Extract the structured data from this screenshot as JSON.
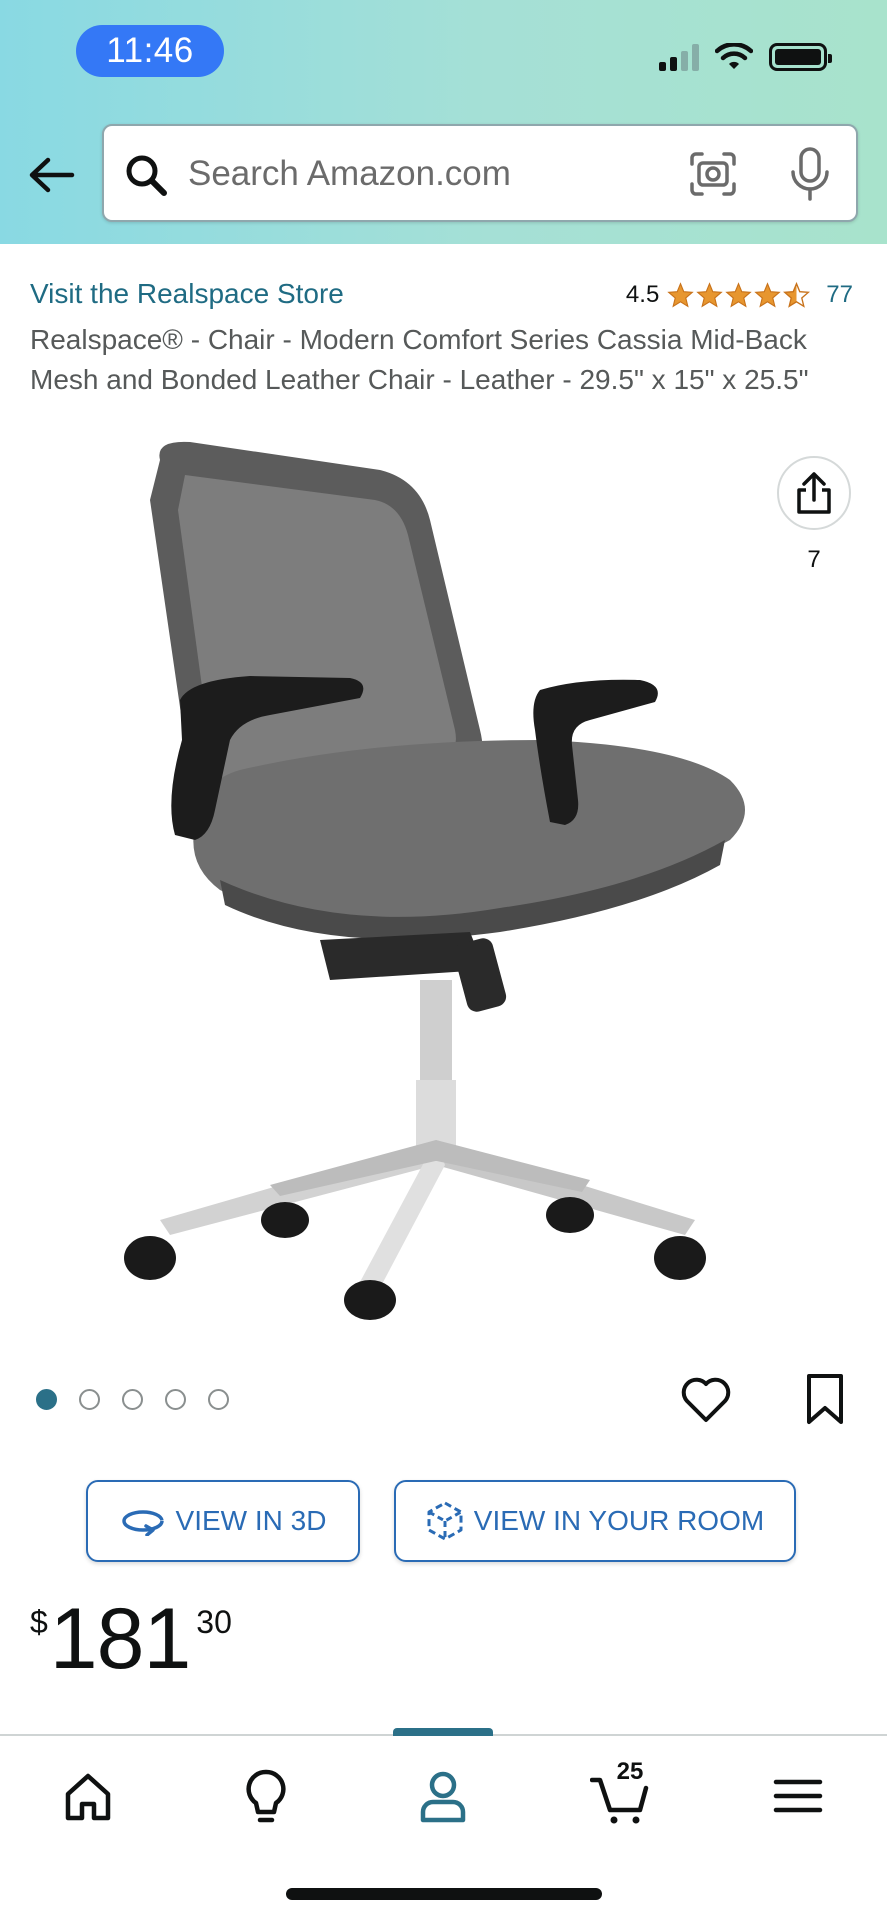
{
  "status_bar": {
    "time": "11:46"
  },
  "search": {
    "placeholder": "Search Amazon.com"
  },
  "product": {
    "store_link": "Visit the Realspace Store",
    "rating_value": "4.5",
    "rating_stars": 4.5,
    "rating_count": "77",
    "title": "Realspace® - Chair - Modern Comfort Series Cassia Mid-Back Mesh and Bonded Leather Chair - Leather - 29.5\" x 15\" x 25.5\"",
    "share_count": "7",
    "image_dots": {
      "total": 5,
      "active": 1
    }
  },
  "actions": {
    "view_3d": "VIEW IN 3D",
    "view_room": "VIEW IN YOUR ROOM"
  },
  "price": {
    "symbol": "$",
    "whole": "181",
    "fraction": "30"
  },
  "bottom_nav": {
    "items": [
      "home-icon",
      "lightbulb-icon",
      "account-icon",
      "cart-icon",
      "menu-icon"
    ],
    "active": "account-icon",
    "cart_count": "25"
  },
  "colors": {
    "link": "#1f6b83",
    "accent": "#2a6bb5",
    "star": "#e7962f",
    "active_dot": "#2b7088"
  }
}
